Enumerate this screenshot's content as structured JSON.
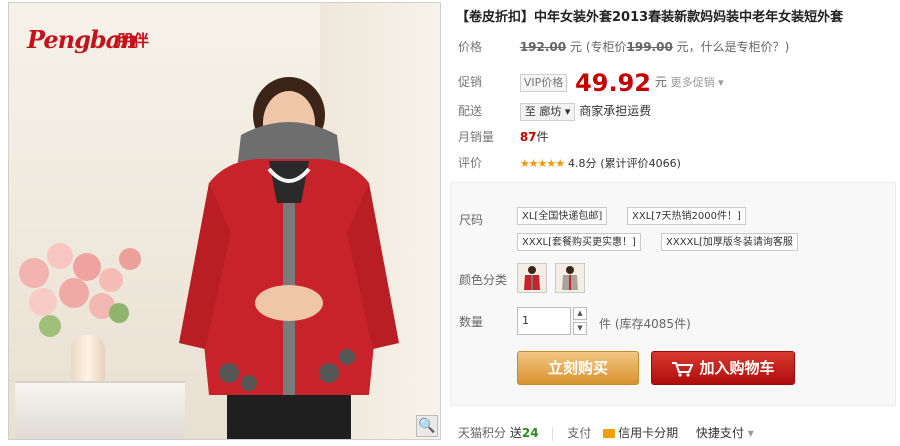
{
  "gallery": {
    "brand_text": "Pengban",
    "brand_cn": "朋伴",
    "zoom_glyph": "🔍",
    "colors": {
      "jacket": "#c8232a",
      "lining": "#7a7a7a"
    }
  },
  "product": {
    "title": "【卷皮折扣】中年女装外套2013春装新款妈妈装中老年女装短外套"
  },
  "price": {
    "label": "价格",
    "original": "192.00",
    "unit": "元",
    "counter_prefix": "(专柜价",
    "counter_price": "199.00",
    "counter_unit": "元，",
    "counter_link": "什么是专柜价？)",
    "promo_label": "促销",
    "vip_tag": "VIP价格",
    "current": "49.92",
    "current_unit": "元",
    "more_promo": "更多促销 ▾"
  },
  "shipping": {
    "label": "配送",
    "to": "至",
    "destination": "廊坊 ▾",
    "note": "商家承担运费"
  },
  "sales": {
    "label": "月销量",
    "count": "87",
    "unit": "件"
  },
  "rating": {
    "label": "评价",
    "stars": "★★★★★",
    "score": "4.8分",
    "count_text": "(累计评价4066)"
  },
  "sku": {
    "size_label": "尺码",
    "sizes": [
      "XL[全国快递包邮]",
      "XXL[7天热销2000件！]",
      "XXXL[套餐购买更实惠！]",
      "XXXXL[加厚版冬装请询客服"
    ],
    "color_label": "颜色分类",
    "color_options": [
      "红色",
      "灰色"
    ],
    "qty_label": "数量",
    "qty_value": "1",
    "qty_unit": "件",
    "stock_text": "(库存4085件)"
  },
  "actions": {
    "buy_now": "立刻购买",
    "add_cart": "加入购物车"
  },
  "footer": {
    "points_label": "天猫积分",
    "points_prefix": "送",
    "points_value": "24",
    "pay_label": "支付",
    "credit": "信用卡分期",
    "quick_pay": "快捷支付",
    "more": "▾"
  }
}
